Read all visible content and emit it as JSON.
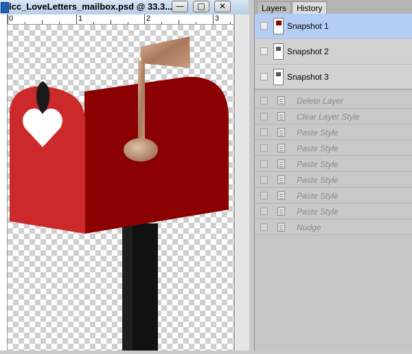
{
  "document": {
    "title": "lcc_LoveLetters_mailbox.psd @ 33.3...",
    "controls": {
      "minimize": "—",
      "maximize": "□",
      "close": "✕"
    },
    "ruler_labels": [
      "0",
      "1",
      "2",
      "3"
    ]
  },
  "panel": {
    "tabs": [
      {
        "label": "Layers",
        "active": false
      },
      {
        "label": "History",
        "active": true
      }
    ],
    "snapshots": [
      {
        "label": "Snapshot 1",
        "selected": true
      },
      {
        "label": "Snapshot 2",
        "selected": false
      },
      {
        "label": "Snapshot 3",
        "selected": false
      }
    ],
    "history": [
      {
        "label": "Delete Layer"
      },
      {
        "label": "Clear Layer Style"
      },
      {
        "label": "Paste Style"
      },
      {
        "label": "Paste Style"
      },
      {
        "label": "Paste Style"
      },
      {
        "label": "Paste Style"
      },
      {
        "label": "Paste Style"
      },
      {
        "label": "Paste Style"
      },
      {
        "label": "Nudge"
      }
    ]
  },
  "colors": {
    "mailbox_dark": "#8b0000",
    "mailbox_light": "#cc2a2a",
    "selected_row": "#b4cdf3",
    "post": "#111111",
    "flag_copper": "#b98a6a"
  }
}
